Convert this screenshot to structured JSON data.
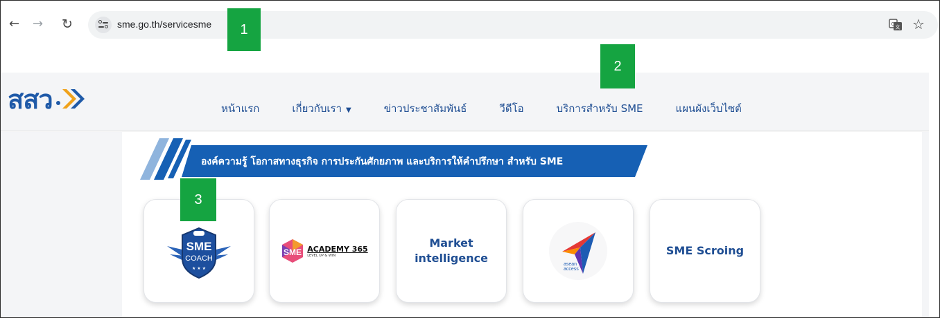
{
  "browser": {
    "url": "sme.go.th/servicesme",
    "icons": [
      "back-arrow-icon",
      "forward-arrow-icon",
      "reload-icon",
      "site-info-icon",
      "translate-icon",
      "bookmark-star-icon"
    ]
  },
  "callouts": [
    "1",
    "2",
    "3"
  ],
  "site": {
    "logo_text": "สสว",
    "menu": [
      "หน้าแรก",
      "เกี่ยวกับเรา",
      "ข่าวประชาสัมพันธ์",
      "วีดีโอ",
      "บริการสำหรับ SME",
      "แผนผังเว็บไซต์"
    ],
    "banner_text": "องค์ความรู้ โอกาสทางธุรกิจ การประกันศักยภาพ และบริการให้คำปรึกษา สำหรับ SME"
  },
  "services": {
    "sme_coach": {
      "badge_top": "SME",
      "badge_bottom": "COACH"
    },
    "academy": {
      "logo": "SME",
      "title": "ACADEMY 365",
      "subtitle": "LEVEL UP & WIN"
    },
    "market": {
      "line1": "Market",
      "line2": "intelligence"
    },
    "asean": {
      "line1": "asean",
      "line2": "access"
    },
    "scoring": {
      "label": "SME Scroing"
    }
  },
  "colors": {
    "brand": "#1f5aa8",
    "banner": "#1660b4",
    "callout": "#15a441"
  }
}
